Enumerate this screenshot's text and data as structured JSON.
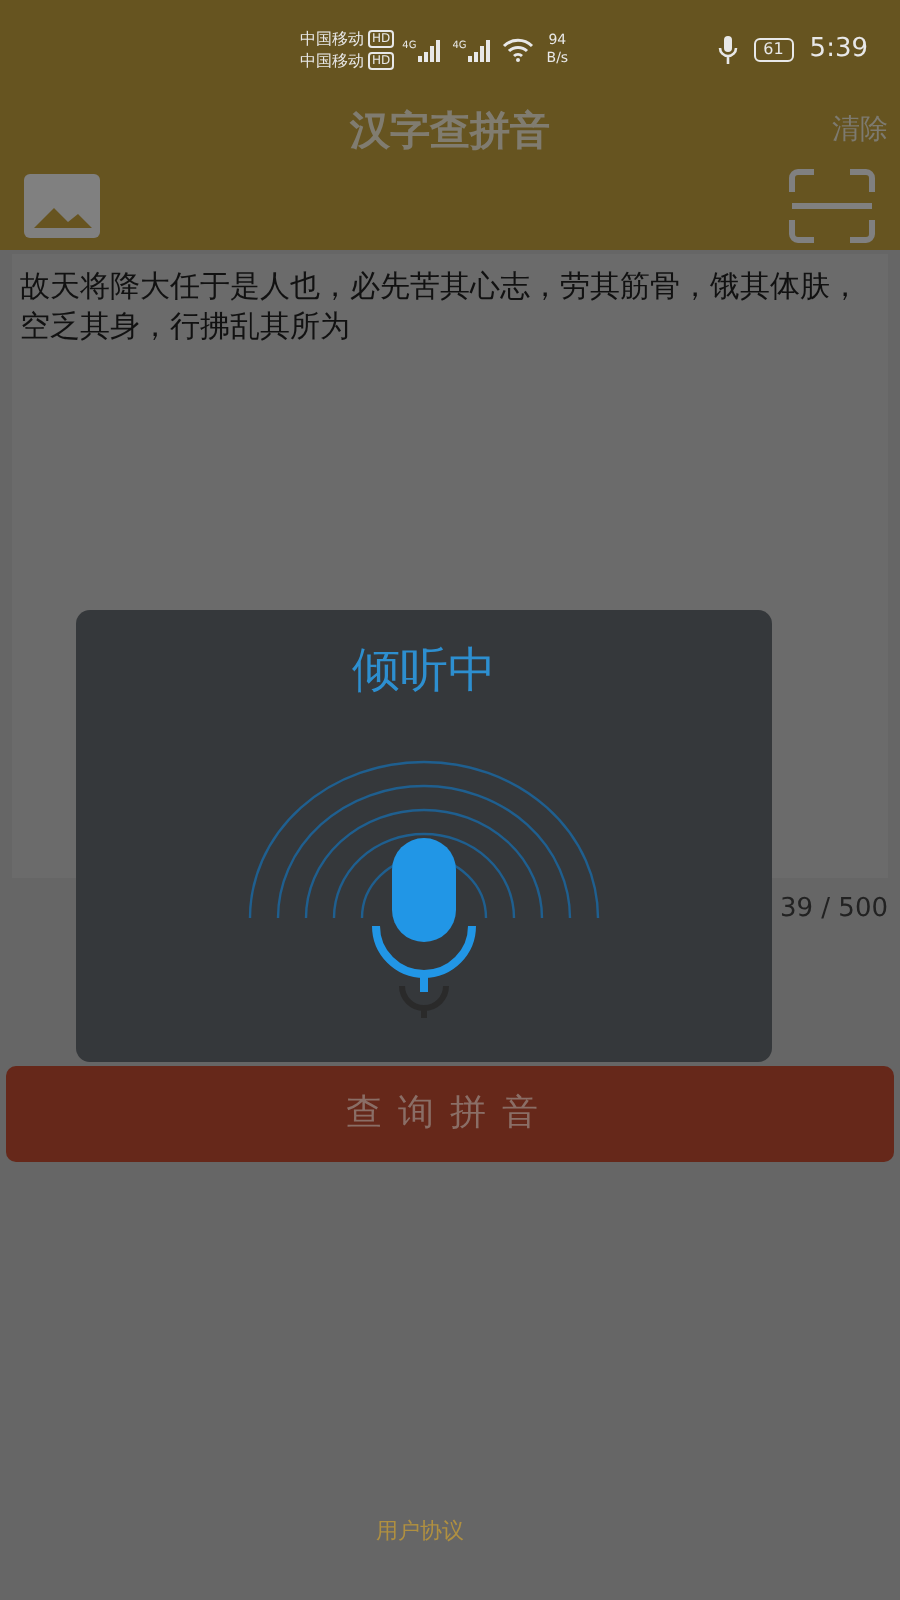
{
  "status_bar": {
    "carriers": [
      "中国移动",
      "中国移动"
    ],
    "hd_badges": [
      "HD",
      "HD"
    ],
    "networks": [
      "4G",
      "4G"
    ],
    "speed": [
      "94",
      "B/s"
    ],
    "battery": "61",
    "time": "5:39"
  },
  "header": {
    "title": "汉字查拼音",
    "action": "清除"
  },
  "input": {
    "value": "故天将降大任于是人也，必先苦其心志，劳其筋骨，饿其体肤，空乏其身，行拂乱其所为",
    "counter": "39 / 500"
  },
  "submit_button": "查询拼音",
  "dialog": {
    "title": "倾听中"
  },
  "footer": {
    "link": "用户协议"
  }
}
